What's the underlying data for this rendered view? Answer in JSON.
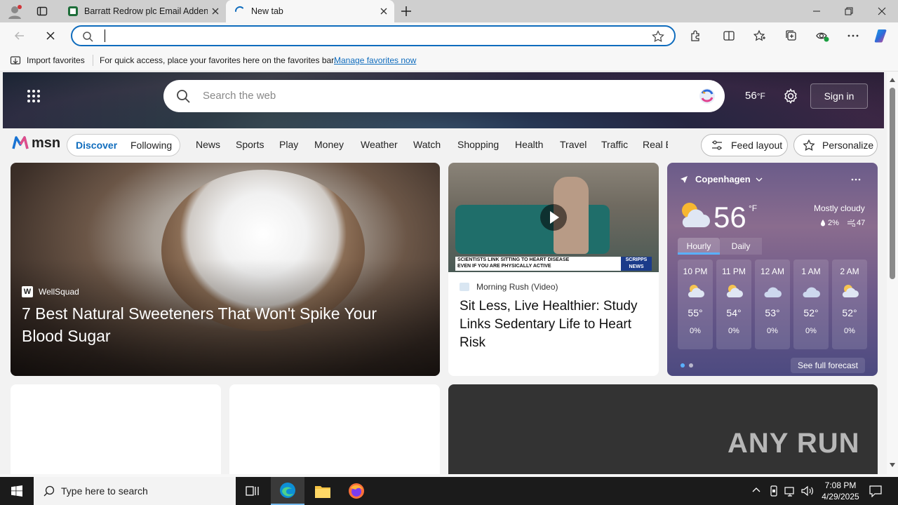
{
  "browser": {
    "tabs": [
      {
        "title": "Barratt Redrow plc Email Addend"
      },
      {
        "title": "New tab"
      }
    ],
    "address": {
      "value": "",
      "placeholder": ""
    },
    "favorites_bar": {
      "import_label": "Import favorites",
      "hint": "For quick access, place your favorites here on the favorites bar.",
      "manage_link": "Manage favorites now"
    }
  },
  "msn": {
    "search_placeholder": "Search the web",
    "temperature": "56",
    "temp_unit": "°F",
    "sign_in": "Sign in",
    "logo_text": "msn",
    "nav": {
      "discover": "Discover",
      "following": "Following",
      "links": [
        "News",
        "Sports",
        "Play",
        "Money",
        "Weather",
        "Watch",
        "Shopping",
        "Health",
        "Travel",
        "Traffic",
        "Real E"
      ]
    },
    "feed_layout": "Feed layout",
    "personalize": "Personalize",
    "hero_card": {
      "source": "WellSquad",
      "headline": "7 Best Natural Sweeteners That Won't Spike Your Blood Sugar"
    },
    "video_card": {
      "caption_line1": "SCIENTISTS LINK SITTING TO HEART DISEASE",
      "caption_line2": "EVEN IF YOU ARE PHYSICALLY ACTIVE",
      "caption_logo": "SCRIPPS NEWS",
      "source": "Morning Rush (Video)",
      "headline": "Sit Less, Live Healthier: Study Links Sedentary Life to Heart Risk"
    },
    "weather": {
      "location": "Copenhagen",
      "temp": "56",
      "unit": "°F",
      "condition": "Mostly cloudy",
      "precip": "2%",
      "wind": "47",
      "tabs": [
        "Hourly",
        "Daily"
      ],
      "hours": [
        {
          "time": "10 PM",
          "temp": "55°",
          "precip": "0%"
        },
        {
          "time": "11 PM",
          "temp": "54°",
          "precip": "0%"
        },
        {
          "time": "12 AM",
          "temp": "53°",
          "precip": "0%"
        },
        {
          "time": "1 AM",
          "temp": "52°",
          "precip": "0%"
        },
        {
          "time": "2 AM",
          "temp": "52°",
          "precip": "0%"
        }
      ],
      "see_full": "See full forecast"
    },
    "watermark": "ANY RUN"
  },
  "taskbar": {
    "search_placeholder": "Type here to search",
    "time": "7:08 PM",
    "date": "4/29/2025"
  },
  "colors": {
    "accent": "#0f6cbd",
    "discover": "#0f6cbd",
    "taskbar": "#1b1b1b"
  }
}
